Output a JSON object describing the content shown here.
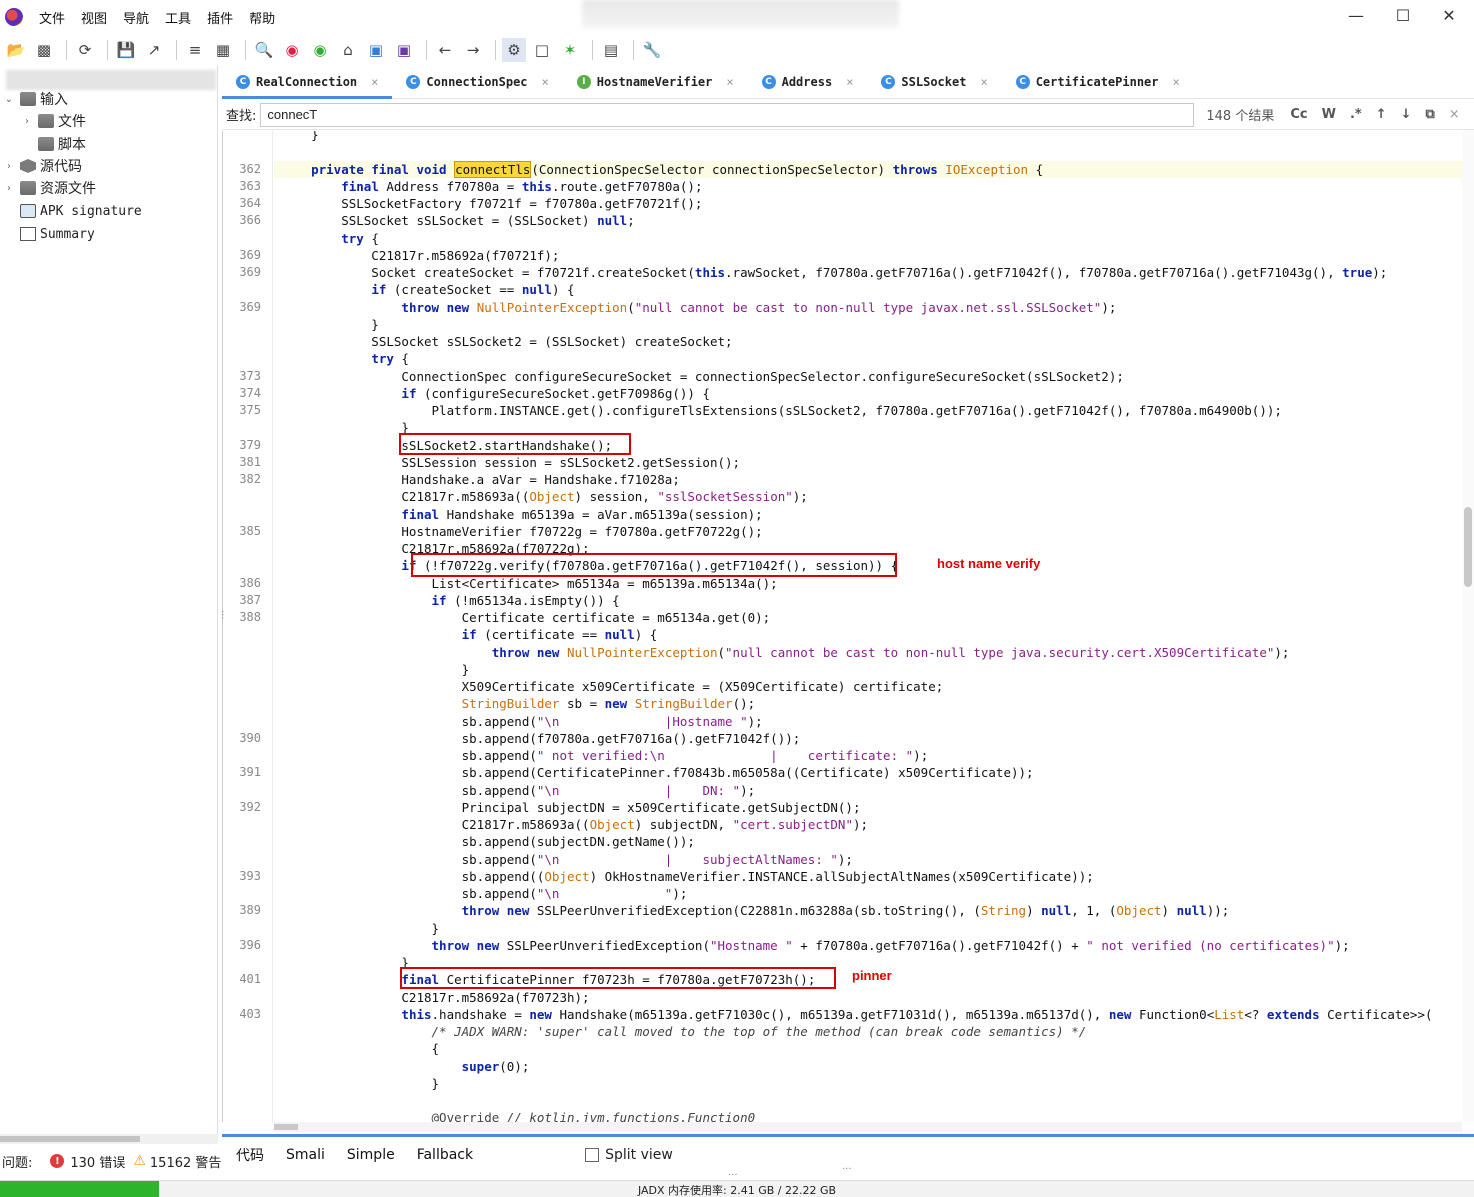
{
  "menu": [
    "文件",
    "视图",
    "导航",
    "工具",
    "插件",
    "帮助"
  ],
  "window_controls": {
    "minimize": "—",
    "maximize": "☐",
    "close": "✕"
  },
  "toolbar_icons": [
    "open-icon",
    "save-all-icon",
    "sync-icon",
    "save-icon",
    "export-icon",
    "flatten-icon",
    "decompile-icon",
    "search-icon",
    "find-class-icon",
    "find-usage-icon",
    "home-icon",
    "window-icon",
    "smali-icon",
    "back-icon",
    "forward-icon",
    "quark-icon",
    "bookmark-icon",
    "debug-icon",
    "log-icon",
    "settings-icon"
  ],
  "sidebar": {
    "items": [
      {
        "label": "输入",
        "icon": "folder-icon",
        "arrow": "⌄",
        "indent": 0
      },
      {
        "label": "文件",
        "icon": "folder-icon",
        "arrow": "›",
        "indent": 1
      },
      {
        "label": "脚本",
        "icon": "folder-icon",
        "arrow": "",
        "indent": 1
      },
      {
        "label": "源代码",
        "icon": "package-icon",
        "arrow": "›",
        "indent": 0
      },
      {
        "label": "资源文件",
        "icon": "folder-icon",
        "arrow": "›",
        "indent": 0
      },
      {
        "label": "APK signature",
        "icon": "signature-icon",
        "arrow": "",
        "indent": 0
      },
      {
        "label": "Summary",
        "icon": "summary-icon",
        "arrow": "",
        "indent": 0
      }
    ]
  },
  "tabs": [
    {
      "label": "RealConnection",
      "icon_letter": "C",
      "icon_color": "#3a8ee6",
      "active": true
    },
    {
      "label": "ConnectionSpec",
      "icon_letter": "C",
      "icon_color": "#3a8ee6",
      "active": false
    },
    {
      "label": "HostnameVerifier",
      "icon_letter": "I",
      "icon_color": "#5aae4a",
      "active": false
    },
    {
      "label": "Address",
      "icon_letter": "C",
      "icon_color": "#3a8ee6",
      "active": false
    },
    {
      "label": "SSLSocket",
      "icon_letter": "C",
      "icon_color": "#3a8ee6",
      "active": false
    },
    {
      "label": "CertificatePinner",
      "icon_letter": "C",
      "icon_color": "#3a8ee6",
      "active": false
    }
  ],
  "tab_close": "×",
  "search": {
    "label": "查找:",
    "value": "connecT",
    "count": "148 个结果",
    "buttons": [
      "Cc",
      "W",
      ".*",
      "↑",
      "↓",
      "⧉",
      "×"
    ]
  },
  "code_lines": [
    {
      "ln": "",
      "html": "    }"
    },
    {
      "ln": "",
      "html": ""
    },
    {
      "ln": "362",
      "html": "    <span class=\"kw\">private final void</span> <span class=\"match\">connectTls</span>(ConnectionSpecSelector connectionSpecSelector) <span class=\"kw\">throws</span> <span class=\"ty\">IOException</span> {",
      "hl": true
    },
    {
      "ln": "363",
      "html": "        <span class=\"kw\">final</span> Address f70780a = <span class=\"kw\">this</span>.route.getF70780a();"
    },
    {
      "ln": "364",
      "html": "        SSLSocketFactory f70721f = f70780a.getF70721f();"
    },
    {
      "ln": "366",
      "html": "        SSLSocket sSLSocket = (SSLSocket) <span class=\"kw\">null</span>;"
    },
    {
      "ln": "",
      "html": "        <span class=\"kw\">try</span> {"
    },
    {
      "ln": "369",
      "html": "            C21817r.m58692a(f70721f);"
    },
    {
      "ln": "369",
      "html": "            Socket createSocket = f70721f.createSocket(<span class=\"kw\">this</span>.rawSocket, f70780a.getF70716a().getF71042f(), f70780a.getF70716a().getF71043g(), <span class=\"kw\">true</span>);"
    },
    {
      "ln": "",
      "html": "            <span class=\"kw\">if</span> (createSocket == <span class=\"kw\">null</span>) {"
    },
    {
      "ln": "369",
      "html": "                <span class=\"kw\">throw new</span> <span class=\"ty\">NullPointerException</span>(<span class=\"st\">\"null cannot be cast to non-null type javax.net.ssl.SSLSocket\"</span>);"
    },
    {
      "ln": "",
      "html": "            }"
    },
    {
      "ln": "",
      "html": "            SSLSocket sSLSocket2 = (SSLSocket) createSocket;"
    },
    {
      "ln": "",
      "html": "            <span class=\"kw\">try</span> {"
    },
    {
      "ln": "373",
      "html": "                ConnectionSpec configureSecureSocket = connectionSpecSelector.configureSecureSocket(sSLSocket2);"
    },
    {
      "ln": "374",
      "html": "                <span class=\"kw\">if</span> (configureSecureSocket.getF70986g()) {"
    },
    {
      "ln": "375",
      "html": "                    Platform.INSTANCE.get().configureTlsExtensions(sSLSocket2, f70780a.getF70716a().getF71042f(), f70780a.m64900b());"
    },
    {
      "ln": "",
      "html": "                }"
    },
    {
      "ln": "379",
      "html": "                sSLSocket2.startHandshake();"
    },
    {
      "ln": "381",
      "html": "                SSLSession session = sSLSocket2.getSession();"
    },
    {
      "ln": "382",
      "html": "                Handshake.a aVar = Handshake.f71028a;"
    },
    {
      "ln": "",
      "html": "                C21817r.m58693a((<span class=\"ty\">Object</span>) session, <span class=\"st\">\"sslSocketSession\"</span>);"
    },
    {
      "ln": "",
      "html": "                <span class=\"kw\">final</span> Handshake m65139a = aVar.m65139a(session);"
    },
    {
      "ln": "385",
      "html": "                HostnameVerifier f70722g = f70780a.getF70722g();"
    },
    {
      "ln": "",
      "html": "                C21817r.m58692a(f70722g);"
    },
    {
      "ln": "",
      "html": "                <span class=\"kw\">if</span> (!f70722g.verify(f70780a.getF70716a().getF71042f(), session)) {"
    },
    {
      "ln": "386",
      "html": "                    List&lt;Certificate&gt; m65134a = m65139a.m65134a();"
    },
    {
      "ln": "387",
      "html": "                    <span class=\"kw\">if</span> (!m65134a.isEmpty()) {"
    },
    {
      "ln": "388",
      "html": "                        Certificate certificate = m65134a.get(0);"
    },
    {
      "ln": "",
      "html": "                        <span class=\"kw\">if</span> (certificate == <span class=\"kw\">null</span>) {"
    },
    {
      "ln": "",
      "html": "                            <span class=\"kw\">throw new</span> <span class=\"ty\">NullPointerException</span>(<span class=\"st\">\"null cannot be cast to non-null type java.security.cert.X509Certificate\"</span>);"
    },
    {
      "ln": "",
      "html": "                        }"
    },
    {
      "ln": "",
      "html": "                        X509Certificate x509Certificate = (X509Certificate) certificate;"
    },
    {
      "ln": "",
      "html": "                        <span class=\"ty\">StringBuilder</span> sb = <span class=\"kw\">new</span> <span class=\"ty\">StringBuilder</span>();"
    },
    {
      "ln": "",
      "html": "                        sb.append(<span class=\"st\">\"\\n              |Hostname \"</span>);"
    },
    {
      "ln": "390",
      "html": "                        sb.append(f70780a.getF70716a().getF71042f());"
    },
    {
      "ln": "",
      "html": "                        sb.append(<span class=\"st\">\" not verified:\\n              |    certificate: \"</span>);"
    },
    {
      "ln": "391",
      "html": "                        sb.append(CertificatePinner.f70843b.m65058a((Certificate) x509Certificate));"
    },
    {
      "ln": "",
      "html": "                        sb.append(<span class=\"st\">\"\\n              |    DN: \"</span>);"
    },
    {
      "ln": "392",
      "html": "                        Principal subjectDN = x509Certificate.getSubjectDN();"
    },
    {
      "ln": "",
      "html": "                        C21817r.m58693a((<span class=\"ty\">Object</span>) subjectDN, <span class=\"st\">\"cert.subjectDN\"</span>);"
    },
    {
      "ln": "",
      "html": "                        sb.append(subjectDN.getName());"
    },
    {
      "ln": "",
      "html": "                        sb.append(<span class=\"st\">\"\\n              |    subjectAltNames: \"</span>);"
    },
    {
      "ln": "393",
      "html": "                        sb.append((<span class=\"ty\">Object</span>) OkHostnameVerifier.INSTANCE.allSubjectAltNames(x509Certificate));"
    },
    {
      "ln": "",
      "html": "                        sb.append(<span class=\"st\">\"\\n              \"</span>);"
    },
    {
      "ln": "389",
      "html": "                        <span class=\"kw\">throw new</span> SSLPeerUnverifiedException(C22881n.m63288a(sb.toString(), (<span class=\"ty\">String</span>) <span class=\"kw\">null</span>, 1, (<span class=\"ty\">Object</span>) <span class=\"kw\">null</span>));"
    },
    {
      "ln": "",
      "html": "                    }"
    },
    {
      "ln": "396",
      "html": "                    <span class=\"kw\">throw new</span> SSLPeerUnverifiedException(<span class=\"st\">\"Hostname \"</span> + f70780a.getF70716a().getF71042f() + <span class=\"st\">\" not verified (no certificates)\"</span>);"
    },
    {
      "ln": "",
      "html": "                }"
    },
    {
      "ln": "401",
      "html": "                <span class=\"kw\">final</span> CertificatePinner f70723h = f70780a.getF70723h();"
    },
    {
      "ln": "",
      "html": "                C21817r.m58692a(f70723h);"
    },
    {
      "ln": "403",
      "html": "                <span class=\"kw\">this</span>.handshake = <span class=\"kw\">new</span> Handshake(m65139a.getF71030c(), m65139a.getF71031d(), m65139a.m65137d(), <span class=\"kw\">new</span> Function0&lt;<span class=\"ty\">List</span>&lt;? <span class=\"kw\">extends</span> Certificate&gt;&gt;("
    },
    {
      "ln": "",
      "html": "                    <span class=\"cm\">/* JADX WARN: 'super' call moved to the top of the method (can break code semantics) */</span>"
    },
    {
      "ln": "",
      "html": "                    {"
    },
    {
      "ln": "",
      "html": "                        <span class=\"kw\">super</span>(0);"
    },
    {
      "ln": "",
      "html": "                    }"
    },
    {
      "ln": "",
      "html": ""
    },
    {
      "ln": "",
      "html": "                    <span class=\"cm\" style=\"font-style:normal\">@Override</span> <span class=\"cm\">// kotlin.jvm.functions.Function0</span>"
    }
  ],
  "annotations": {
    "host_name_verify": "host name verify",
    "pinner": "pinner"
  },
  "view_tabs": [
    "代码",
    "Smali",
    "Simple",
    "Fallback"
  ],
  "split_view": "Split view",
  "problems": {
    "label": "问题:",
    "errors": "130 错误",
    "warnings": "15162 警告"
  },
  "status": {
    "memory_text": "JADX 内存使用率: 2.41 GB / 22.22 GB",
    "memory_fraction": 0.108
  }
}
